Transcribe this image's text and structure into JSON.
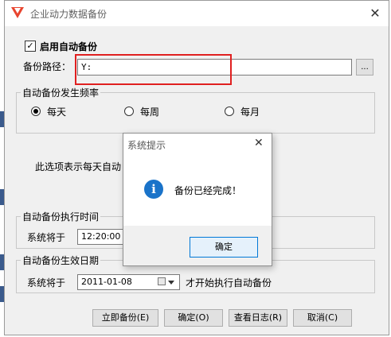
{
  "window": {
    "title": "企业动力数据备份",
    "close_symbol": "✕"
  },
  "auto_backup": {
    "checkbox_label": "启用自动备份",
    "checked": true,
    "checkmark": "✓"
  },
  "path": {
    "label": "备份路径：",
    "value": "Y:",
    "browse_label": "..."
  },
  "frequency": {
    "group_title": "自动备份发生频率",
    "options": [
      {
        "label": "每天",
        "selected": true
      },
      {
        "label": "每周",
        "selected": false
      },
      {
        "label": "每月",
        "selected": false
      }
    ],
    "description": "此选项表示每天自动"
  },
  "exec_time": {
    "group_title": "自动备份执行时间",
    "label": "系统将于",
    "time_value": "12:20:00"
  },
  "effective_date": {
    "group_title": "自动备份生效日期",
    "label": "系统将于",
    "date_value": "2011-01-08",
    "suffix": "才开始执行自动备份"
  },
  "buttons": {
    "backup_now": "立即备份(E)",
    "ok": "确定(O)",
    "view_log": "查看日志(R)",
    "cancel": "取消(C)"
  },
  "dialog": {
    "title": "系统提示",
    "close_symbol": "✕",
    "message": "备份已经完成！",
    "icon_glyph": "i",
    "ok_label": "确定"
  },
  "colors": {
    "accent": "#1a73c9",
    "highlight_box": "#e02020",
    "logo": "#e8442e"
  }
}
